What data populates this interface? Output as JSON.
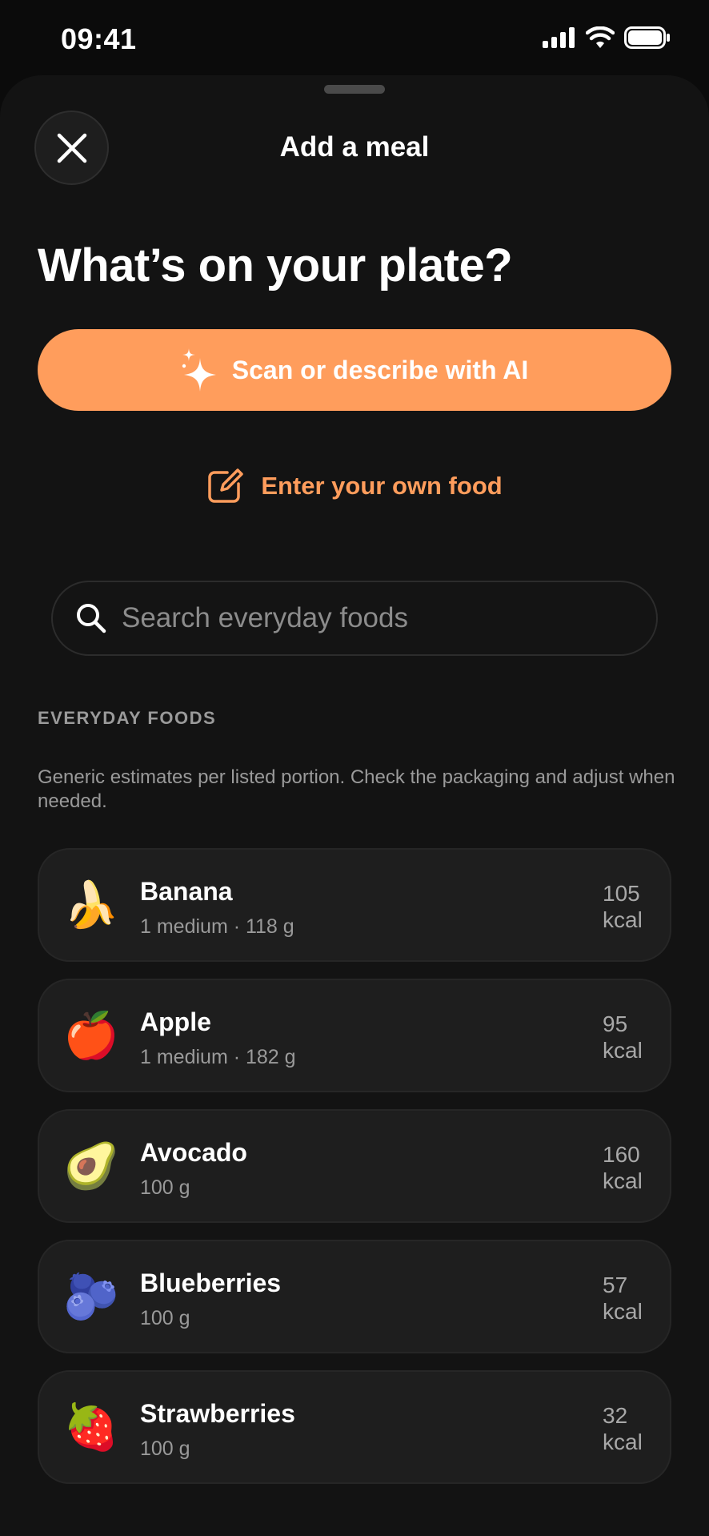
{
  "status_bar": {
    "time": "09:41"
  },
  "sheet": {
    "title": "Add a meal"
  },
  "headline": "What’s on your plate?",
  "actions": {
    "ai_button_label": "Scan or describe with AI",
    "own_food_label": "Enter your own food"
  },
  "search": {
    "placeholder": "Search everyday foods"
  },
  "everyday": {
    "section_label": "EVERYDAY FOODS",
    "note": "Generic estimates per listed portion. Check the packaging and adjust when needed.",
    "items": [
      {
        "emoji": "🍌",
        "name": "Banana",
        "portion": "1 medium · 118 g",
        "kcal_value": "105",
        "kcal_unit": "kcal"
      },
      {
        "emoji": "🍎",
        "name": "Apple",
        "portion": "1 medium · 182 g",
        "kcal_value": "95",
        "kcal_unit": "kcal"
      },
      {
        "emoji": "🥑",
        "name": "Avocado",
        "portion": "100 g",
        "kcal_value": "160",
        "kcal_unit": "kcal"
      },
      {
        "emoji": "🫐",
        "name": "Blueberries",
        "portion": "100 g",
        "kcal_value": "57",
        "kcal_unit": "kcal"
      },
      {
        "emoji": "🍓",
        "name": "Strawberries",
        "portion": "100 g",
        "kcal_value": "32",
        "kcal_unit": "kcal"
      }
    ]
  },
  "colors": {
    "accent": "#ff9d5c",
    "background": "#0b0b0b",
    "sheet": "#131313",
    "card": "#1e1e1e",
    "muted_text": "#9a9a9a"
  },
  "icons": {
    "close": "close-icon",
    "ai": "sparkles-icon",
    "own_food": "edit-icon",
    "search": "search-icon"
  }
}
